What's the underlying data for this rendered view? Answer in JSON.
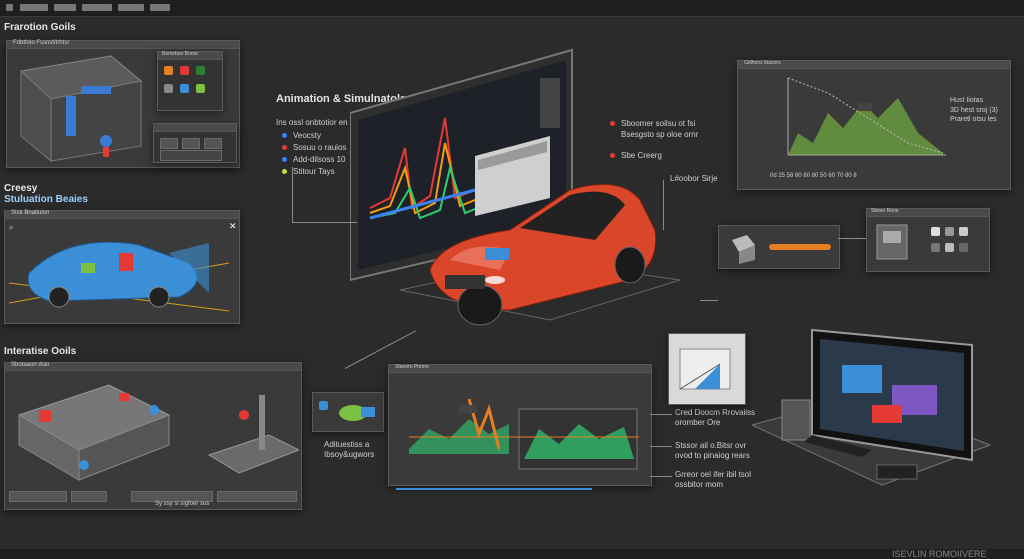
{
  "sections": {
    "top_left": "Frarotion Goils",
    "animation": "Animation & Simulnatols",
    "mid_left_1": "Creesy",
    "mid_left_2": "Stuluation Beaies",
    "bottom_left": "Interatise Ooils"
  },
  "legend_left": {
    "heading": "Ins ossl onbtotior en",
    "items": [
      {
        "text": "Veocsty",
        "color": "#3b82f6"
      },
      {
        "text": "Sosuu o rauios",
        "color": "#e53935"
      },
      {
        "text": "Add-dilsoss 10",
        "color": "#3b82f6"
      },
      {
        "text": "Stitour Tays",
        "color": "#cddc39"
      }
    ]
  },
  "legend_right": {
    "items": [
      {
        "text": "Sboomer soilsu ot fsi",
        "color": "#e53935"
      },
      {
        "text": "Bsesgsto sp oloe ornr",
        "color": "#e53935"
      },
      {
        "text": "Sbe Creerg",
        "color": "#e53935"
      }
    ]
  },
  "callouts": {
    "library": "L#oobor Sirje",
    "chart_note_1": "Hust Iiotas",
    "chart_note_2": "3D hest sroj (3)",
    "chart_note_3": "Praretl otsu les",
    "assist": "Adituestiss a",
    "assist_2": "Ibsoy&ugwors",
    "right_1": "Cred Doocm Rrovaiiss",
    "right_2": "oromber Ore",
    "right_3": "Stssor ail o.Bitsr ovr",
    "right_4": "ovod to pinaiog rears",
    "right_5": "Grreor oel ifer ibil tsol",
    "right_6": "ossbitor mom",
    "bottom_left_status": "Sy ssy si sigfoer sus",
    "bottom_strip": "ISEVLIN ROMOIIVERE"
  },
  "windows": {
    "w1_title": "Fdbtfoio Fssnsf/Irhtsr",
    "w1_panel": "Bemetosr Bonsc",
    "w2_title": "Stsk Bnaltuion",
    "w3_title": "Sbotaaon dsio",
    "w4_title": "Gldhons Ibaoors",
    "w5_title": "Sbeso Rone",
    "w6_title": "Stanoro Pnrore"
  },
  "chart_small": {
    "ticks": [
      "0d",
      "25",
      "58",
      "80",
      "80",
      "80",
      "50",
      "60",
      "70",
      "80",
      "8"
    ],
    "ylabels": [
      "00",
      "00",
      "60",
      "50",
      "60",
      "30",
      "20",
      "10",
      "0"
    ]
  },
  "colors": {
    "car": "#d9462a",
    "car_blue": "#3b8fd6",
    "bg": "#2b2b2b",
    "panel": "#3a3a3a",
    "green": "#7cc142"
  }
}
